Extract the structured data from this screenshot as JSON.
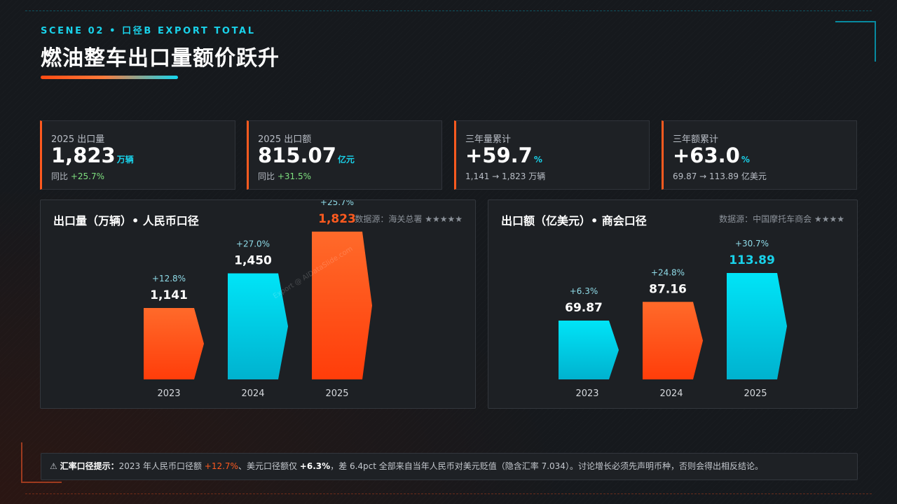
{
  "header": {
    "eyebrow": "SCENE 02 • 口径B EXPORT TOTAL",
    "title": "燃油整车出口量额价跃升"
  },
  "kpis": [
    {
      "label": "2025 出口量",
      "value": "1,823",
      "unit": "万辆",
      "sub_prefix": "同比 ",
      "sub_delta": "+25.7%"
    },
    {
      "label": "2025 出口额",
      "value": "815.07",
      "unit": "亿元",
      "sub_prefix": "同比 ",
      "sub_delta": "+31.5%"
    },
    {
      "label": "三年量累计",
      "value": "+59.7",
      "unit": "%",
      "sub_text": "1,141 → 1,823 万辆"
    },
    {
      "label": "三年额累计",
      "value": "+63.0",
      "unit": "%",
      "sub_text": "69.87 → 113.89 亿美元"
    }
  ],
  "chart_data": [
    {
      "type": "bar",
      "title": "出口量（万辆）• 人民币口径",
      "source": "数据源：海关总署 ★★★★★",
      "categories": [
        "2023",
        "2024",
        "2025"
      ],
      "values": [
        1141,
        1450,
        1823
      ],
      "value_labels": [
        "1,141",
        "1,450",
        "1,823"
      ],
      "growth_labels": [
        "+12.8%",
        "+27.0%",
        "+25.7%"
      ],
      "bar_colors": [
        "orange",
        "cyan",
        "orange"
      ],
      "highlight_index": 2,
      "watermark": "Export @ AIDataSlide.com"
    },
    {
      "type": "bar",
      "title": "出口额（亿美元）• 商会口径",
      "source": "数据源：中国摩托车商会 ★★★★",
      "categories": [
        "2023",
        "2024",
        "2025"
      ],
      "values": [
        69.87,
        87.16,
        113.89
      ],
      "value_labels": [
        "69.87",
        "87.16",
        "113.89"
      ],
      "growth_labels": [
        "+6.3%",
        "+24.8%",
        "+30.7%"
      ],
      "bar_colors": [
        "cyan",
        "orange",
        "cyan"
      ],
      "highlight_index": 2
    }
  ],
  "colors": {
    "accent_cyan": "#19d2ea",
    "accent_orange": "#ff5a1f",
    "positive_green": "#7ee07f",
    "background": "#16191d"
  },
  "note": {
    "icon": "⚠",
    "label": "汇率口径提示：",
    "text_1": "2023 年人民币口径额 ",
    "rmb_growth": "+12.7%",
    "text_2": "、美元口径额仅 ",
    "usd_growth": "+6.3%",
    "text_3": "，差 6.4pct 全部来自当年人民币对美元贬值（隐含汇率 7.034）。讨论增长必须先声明币种，否则会得出相反结论。"
  }
}
